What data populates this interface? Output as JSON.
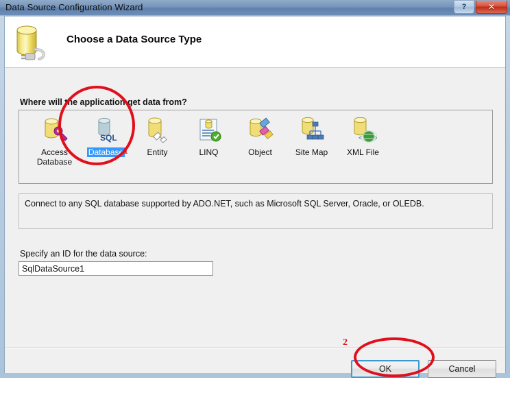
{
  "window": {
    "title": "Data Source Configuration Wizard",
    "help_button": "?",
    "close_button": "✕",
    "help_icon": "help-icon",
    "close_icon": "close-icon"
  },
  "header": {
    "title": "Choose a Data Source Type",
    "icon": "database-plug-icon"
  },
  "main": {
    "question_label": "Where will the application get data from?",
    "sources": [
      {
        "label": "Access Database",
        "icon": "access-database-icon",
        "selected": false
      },
      {
        "label": "Database",
        "icon": "sql-database-icon",
        "selected": true
      },
      {
        "label": "Entity",
        "icon": "entity-icon",
        "selected": false
      },
      {
        "label": "LINQ",
        "icon": "linq-icon",
        "selected": false
      },
      {
        "label": "Object",
        "icon": "object-icon",
        "selected": false
      },
      {
        "label": "Site Map",
        "icon": "site-map-icon",
        "selected": false
      },
      {
        "label": "XML File",
        "icon": "xml-file-icon",
        "selected": false
      }
    ],
    "description": "Connect to any SQL database supported by ADO.NET, such as Microsoft SQL Server, Oracle, or OLEDB.",
    "id_label": "Specify an ID for the data source:",
    "id_value": "SqlDataSource1",
    "id_placeholder": "SqlDataSource1"
  },
  "footer": {
    "ok_label": "OK",
    "cancel_label": "Cancel"
  },
  "annotations": [
    {
      "number": "1",
      "target": "database-source-item"
    },
    {
      "number": "2",
      "target": "ok-button"
    }
  ],
  "colors": {
    "accent": "#3399ff",
    "annotation": "#e00f1c",
    "titlebar": "#7795ba",
    "dialog_bg": "#f0f0f0",
    "focus_border": "#3c99d4"
  }
}
